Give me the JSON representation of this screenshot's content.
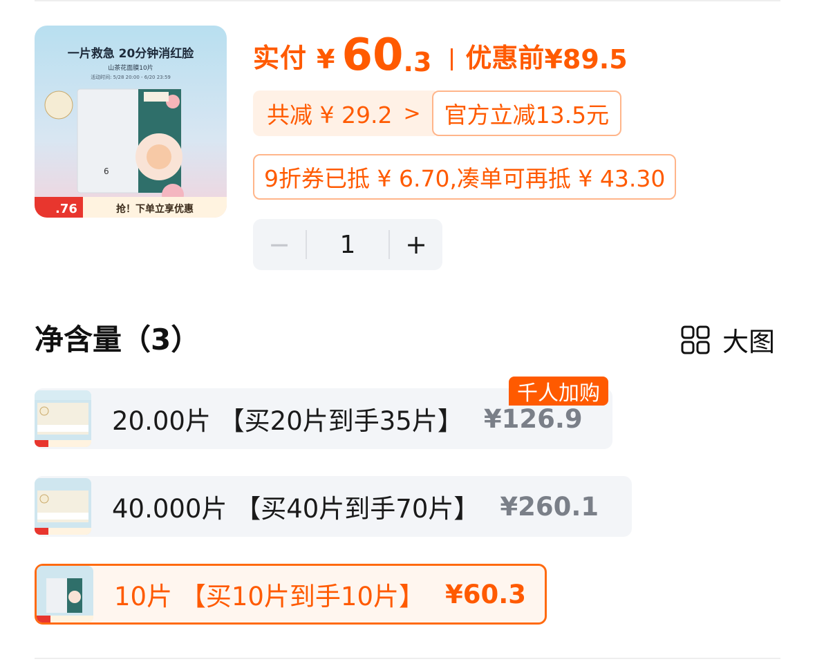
{
  "product": {
    "image_alt": "product-thumbnail",
    "image_overlay": {
      "headline": "一片救急 20分钟消红脸",
      "subline": "山茶花面膜10片",
      "dates": "活动时间: 5/28 20:00 - 6/20 23:59",
      "price_tag": ".76",
      "cta": "抢！下单立享优惠"
    }
  },
  "price": {
    "paid_label": "实付",
    "currency": "¥",
    "integer": "60",
    "decimal": ".3",
    "original_label": "优惠前",
    "original": "¥89.5"
  },
  "discounts": {
    "total": "共减 ¥ 29.2",
    "total_arrow": ">",
    "official": "官方立减13.5元",
    "coupon": "9折券已抵 ¥ 6.70,凑单可再抵 ¥ 43.30"
  },
  "stepper": {
    "minus": "−",
    "quantity": "1",
    "plus": "+"
  },
  "section": {
    "title": "净含量（3）",
    "big_view": "大图"
  },
  "skus": [
    {
      "label": "20.00片 【买20片到手35片】",
      "price": "¥126.9",
      "badge": "千人加购",
      "selected": false
    },
    {
      "label": "40.000片 【买40片到手70片】",
      "price": "¥260.1",
      "selected": false
    },
    {
      "label": "10片 【买10片到手10片】",
      "price": "¥60.3",
      "selected": true
    }
  ],
  "colors": {
    "accent": "#ff5a00",
    "chip_bg": "#fff1e6",
    "chip_border": "#ffb58a",
    "option_bg": "#f3f5f8",
    "muted": "#7a7f88"
  },
  "icons": {
    "grid": "grid-icon",
    "arrow": "chevron-right-icon"
  }
}
